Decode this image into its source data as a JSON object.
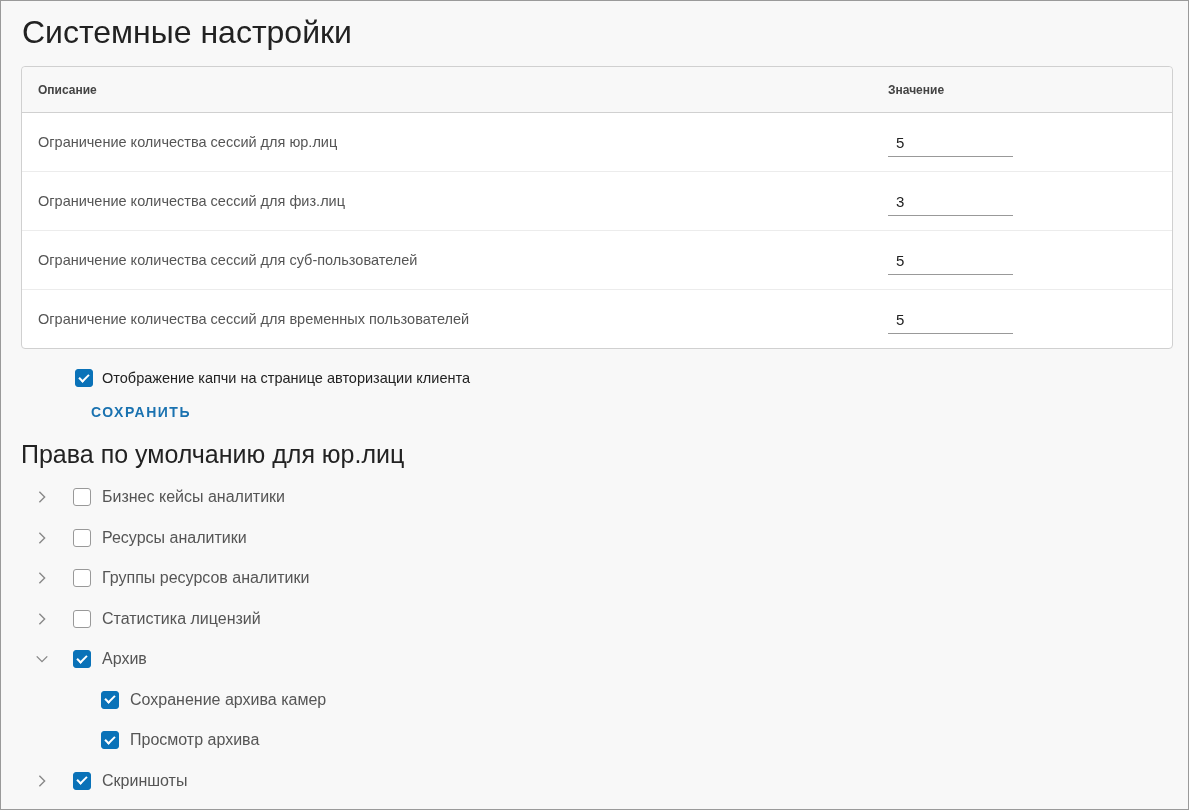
{
  "title": "Системные настройки",
  "table": {
    "columns": [
      "Описание",
      "Значение"
    ],
    "rows": [
      {
        "description": "Ограничение количества сессий для юр.лиц",
        "value": "5"
      },
      {
        "description": "Ограничение количества сессий для физ.лиц",
        "value": "3"
      },
      {
        "description": "Ограничение количества сессий для суб-пользователей",
        "value": "5"
      },
      {
        "description": "Ограничение количества сессий для временных пользователей",
        "value": "5"
      }
    ]
  },
  "captcha": {
    "label": "Отображение капчи на странице авторизации клиента",
    "checked": true
  },
  "save_button": "СОХРАНИТЬ",
  "rights": {
    "title": "Права по умолчанию для юр.лиц",
    "items": [
      {
        "label": "Бизнес кейсы аналитики",
        "checked": false,
        "expanded": false
      },
      {
        "label": "Ресурсы аналитики",
        "checked": false,
        "expanded": false
      },
      {
        "label": "Группы ресурсов аналитики",
        "checked": false,
        "expanded": false
      },
      {
        "label": "Статистика лицензий",
        "checked": false,
        "expanded": false
      },
      {
        "label": "Архив",
        "checked": true,
        "expanded": true,
        "children": [
          {
            "label": "Сохранение архива камер",
            "checked": true
          },
          {
            "label": "Просмотр архива",
            "checked": true
          }
        ]
      },
      {
        "label": "Скриншоты",
        "checked": true,
        "expanded": false
      }
    ]
  }
}
